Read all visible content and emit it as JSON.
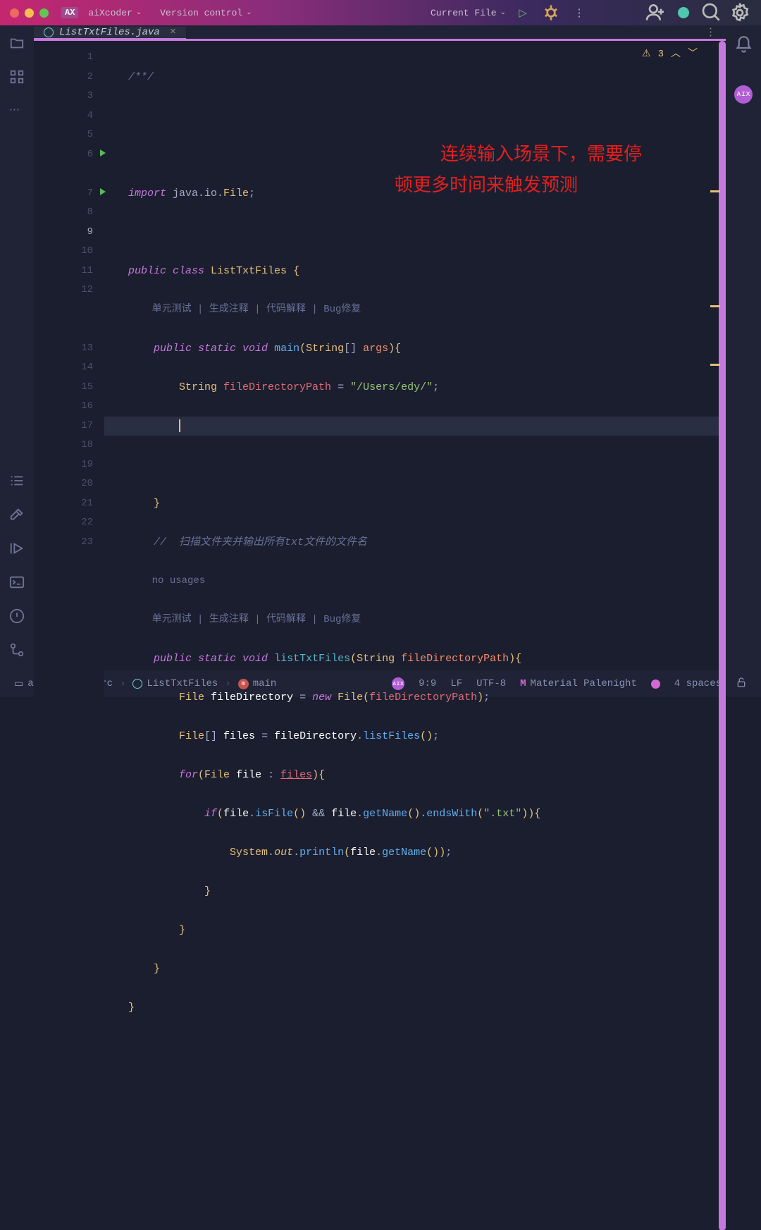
{
  "titlebar": {
    "traffic": {
      "close": "#ed6a5e",
      "min": "#f5bf4f",
      "max": "#61c554"
    },
    "ax_badge": "AX",
    "app_name": "aiXcoder",
    "version_control": "Version control",
    "current_file": "Current File"
  },
  "tabs": {
    "file_name": "ListTxtFiles.java"
  },
  "warnings": {
    "count": "3"
  },
  "overlay": {
    "line1": "连续输入场景下，需要停",
    "line2": "顿更多时间来触发预测"
  },
  "gutter_lines": [
    "1",
    "2",
    "3",
    "4",
    "5",
    "6",
    "7",
    "8",
    "9",
    "10",
    "11",
    "12",
    "13",
    "14",
    "15",
    "16",
    "17",
    "18",
    "19",
    "20",
    "21",
    "22",
    "23"
  ],
  "current_line": 9,
  "run_lines": [
    6,
    7
  ],
  "code": {
    "l1": "/**/",
    "l4_import": "import",
    "l4_pkg": " java.io.",
    "l4_cls": "File",
    "l4_semi": ";",
    "l6_pub": "public ",
    "l6_class": "class ",
    "l6_name": "ListTxtFiles ",
    "l6_b": "{",
    "hint1": "    单元测试 | 生成注释 | 代码解释 | Bug修复",
    "l7_ps": "public static ",
    "l7_void": "void ",
    "l7_main": "main",
    "l7_op": "(",
    "l7_str": "String",
    "l7_arr": "[] ",
    "l7_args": "args",
    "l7_cp": ")",
    "l7_b": "{",
    "l8_str": "String ",
    "l8_var": "fileDirectoryPath ",
    "l8_eq": "= ",
    "l8_val": "\"/Users/edy/\"",
    "l8_semi": ";",
    "l11_b": "}",
    "l12_cm": "//  扫描文件夹并输出所有txt文件的文件名",
    "l12b_nu": "no usages",
    "l12b_hint": "单元测试 | 生成注释 | 代码解释 | Bug修复",
    "l13_ps": "public static ",
    "l13_void": "void ",
    "l13_fn": "listTxtFiles",
    "l13_op": "(",
    "l13_str": "String ",
    "l13_arg": "fileDirectoryPath",
    "l13_cp": ")",
    "l13_b": "{",
    "l14_cls": "File ",
    "l14_var": "fileDirectory ",
    "l14_eq": "= ",
    "l14_new": "new ",
    "l14_ctor": "File",
    "l14_op": "(",
    "l14_arg": "fileDirectoryPath",
    "l14_cp": ")",
    "l14_semi": ";",
    "l15_cls": "File",
    "l15_arr": "[] ",
    "l15_var": "files ",
    "l15_eq": "= ",
    "l15_obj": "fileDirectory",
    "l15_dot": ".",
    "l15_fn": "listFiles",
    "l15_paren": "()",
    "l15_semi": ";",
    "l16_for": "for",
    "l16_op": "(",
    "l16_cls": "File ",
    "l16_var": "file ",
    "l16_col": ": ",
    "l16_arr": "files",
    "l16_cp": ")",
    "l16_b": "{",
    "l17_if": "if",
    "l17_op": "(",
    "l17_obj": "file",
    "l17_d1": ".",
    "l17_fn1": "isFile",
    "l17_p1": "() ",
    "l17_and": "&& ",
    "l17_obj2": "file",
    "l17_d2": ".",
    "l17_fn2": "getName",
    "l17_p2": "()",
    "l17_d3": ".",
    "l17_fn3": "endsWith",
    "l17_op2": "(",
    "l17_str": "\".txt\"",
    "l17_cp2": ")",
    "l17_cp": ")",
    "l17_b": "{",
    "l18_sys": "System",
    "l18_d1": ".",
    "l18_out": "out",
    "l18_d2": ".",
    "l18_fn": "println",
    "l18_op": "(",
    "l18_obj": "file",
    "l18_d3": ".",
    "l18_fn2": "getName",
    "l18_p": "()",
    "l18_cp": ")",
    "l18_semi": ";",
    "l19_b": "}",
    "l20_b": "}",
    "l21_b": "}",
    "l22_b": "}"
  },
  "breadcrumb": {
    "p0": "aiXcoder",
    "p1": "src",
    "p2": "ListTxtFiles",
    "p3": "main"
  },
  "statusbar": {
    "pos": "9:9",
    "eol": "LF",
    "enc": "UTF-8",
    "theme": "Material Palenight",
    "indent": "4 spaces",
    "theme_icon": "M"
  }
}
